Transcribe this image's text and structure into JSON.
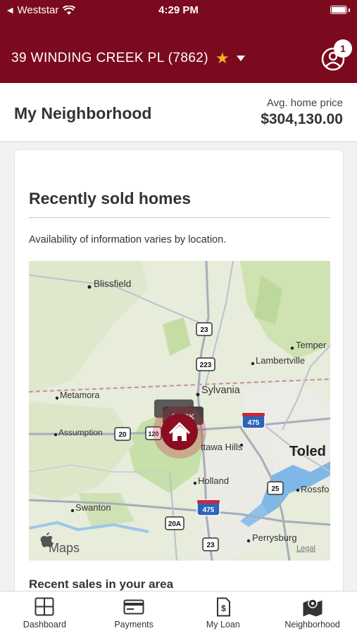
{
  "status": {
    "carrier": "Weststar",
    "time": "4:29 PM"
  },
  "header": {
    "address": "39 WINDING CREEK PL (7862)",
    "notification_count": "1"
  },
  "section": {
    "title": "My Neighborhood",
    "avg_label": "Avg. home price",
    "avg_value": "$304,130.00"
  },
  "card": {
    "title": "Recently sold homes",
    "note": "Availability of information varies by location.",
    "recent_title": "Recent sales in your area"
  },
  "map": {
    "places": [
      "Blissfield",
      "Sylvania",
      "Metamora",
      "Assumption",
      "Lambertville",
      "Temper",
      "Holland",
      "Toled",
      "Swanton",
      "Perrysburg",
      "Rossfo",
      "ttawa Hills"
    ],
    "highways": [
      "23",
      "223",
      "475",
      "20",
      "120",
      "25",
      "20A",
      "475",
      "23"
    ],
    "price_tag": "$170K",
    "provider": "Maps",
    "legal": "Legal"
  },
  "tabs": [
    {
      "label": "Dashboard",
      "icon": "dashboard-icon"
    },
    {
      "label": "Payments",
      "icon": "payments-icon"
    },
    {
      "label": "My Loan",
      "icon": "my-loan-icon"
    },
    {
      "label": "Neighborhood",
      "icon": "neighborhood-icon"
    }
  ],
  "colors": {
    "brand": "#7b0a1f",
    "star": "#f5b21a",
    "map_land": "#e6ecda",
    "map_green": "#c9dfae"
  }
}
